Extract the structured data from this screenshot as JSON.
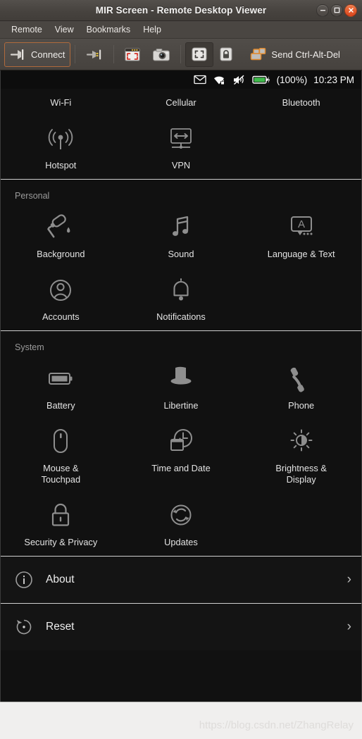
{
  "window": {
    "title": "MIR Screen - Remote Desktop Viewer",
    "buttons": {
      "minimize": "minimize",
      "maximize": "maximize",
      "close": "close"
    }
  },
  "menubar": {
    "items": [
      {
        "label": "Remote",
        "name": "menu-remote"
      },
      {
        "label": "View",
        "name": "menu-view"
      },
      {
        "label": "Bookmarks",
        "name": "menu-bookmarks"
      },
      {
        "label": "Help",
        "name": "menu-help"
      }
    ]
  },
  "toolbar": {
    "connect_label": "Connect",
    "disconnect_label": "",
    "fullscreen_label": "",
    "screenshot_label": "",
    "scaling_label": "",
    "readonly_label": "",
    "send_cad_label": "Send Ctrl-Alt-Del",
    "icons": {
      "connect": "connect-plug-icon",
      "disconnect": "disconnect-plug-icon",
      "fullscreen": "fullscreen-icon",
      "screenshot": "camera-icon",
      "scaling": "scaling-icon",
      "readonly": "lock-icon",
      "send_cad": "keyboard-windows-icon"
    }
  },
  "statusbar": {
    "message_icon": "envelope-icon",
    "wifi_icon": "wifi-locked-icon",
    "sound_icon": "volume-muted-icon",
    "battery_icon": "battery-charging-icon",
    "battery_text": "(100%)",
    "time": "10:23 PM"
  },
  "screen": {
    "network_section": {
      "title": "",
      "items": [
        {
          "label": "Wi-Fi",
          "icon": "wifi-icon"
        },
        {
          "label": "Cellular",
          "icon": "cellular-icon"
        },
        {
          "label": "Bluetooth",
          "icon": "bluetooth-icon"
        },
        {
          "label": "Hotspot",
          "icon": "hotspot-icon"
        },
        {
          "label": "VPN",
          "icon": "vpn-icon"
        }
      ]
    },
    "personal_section": {
      "title": "Personal",
      "items": [
        {
          "label": "Background",
          "icon": "paint-roller-icon"
        },
        {
          "label": "Sound",
          "icon": "music-note-icon"
        },
        {
          "label": "Language & Text",
          "icon": "language-bubble-icon"
        },
        {
          "label": "Accounts",
          "icon": "user-circle-icon"
        },
        {
          "label": "Notifications",
          "icon": "bell-icon"
        }
      ]
    },
    "system_section": {
      "title": "System",
      "items": [
        {
          "label": "Battery",
          "icon": "battery-icon"
        },
        {
          "label": "Libertine",
          "icon": "top-hat-icon"
        },
        {
          "label": "Phone",
          "icon": "phone-handset-icon"
        },
        {
          "label": "Mouse &\nTouchpad",
          "icon": "mouse-icon"
        },
        {
          "label": "Time and Date",
          "icon": "clock-calendar-icon"
        },
        {
          "label": "Brightness &\nDisplay",
          "icon": "brightness-icon"
        },
        {
          "label": "Security & Privacy",
          "icon": "padlock-icon"
        },
        {
          "label": "Updates",
          "icon": "refresh-circle-icon"
        }
      ]
    },
    "list_rows": [
      {
        "label": "About",
        "icon": "info-circle-icon",
        "chevron": "›"
      },
      {
        "label": "Reset",
        "icon": "reset-circle-icon",
        "chevron": "›"
      }
    ]
  },
  "watermark": {
    "text": "https://blog.csdn.net/ZhangRelay"
  },
  "colors": {
    "titlebar": "#47433f",
    "toolbar": "#4b4743",
    "screen_bg": "#111111",
    "accent_orange": "#d9451d",
    "battery_green": "#3fba4b",
    "divider": "#cfcfcf",
    "icon_grey": "#8e8e8e",
    "label_grey": "#e3e3e3"
  }
}
